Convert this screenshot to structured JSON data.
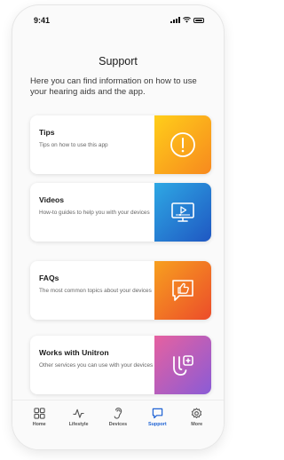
{
  "status_bar": {
    "time": "9:41"
  },
  "page": {
    "title": "Support",
    "intro": "Here you can find information on how to use your hearing aids and the app."
  },
  "cards": [
    {
      "title": "Tips",
      "description": "Tips on how to use this app",
      "icon": "exclamation-circle-icon",
      "gradient": [
        "#ffce1a",
        "#f7891e"
      ]
    },
    {
      "title": "Videos",
      "description": "How-to guides to help you with your devices",
      "icon": "monitor-play-icon",
      "gradient": [
        "#2ea8e4",
        "#1f57c2"
      ]
    },
    {
      "title": "FAQs",
      "description": "The most common topics about your devices",
      "icon": "thumbs-up-bubble-icon",
      "gradient": [
        "#f7a01f",
        "#ec4c2a"
      ]
    },
    {
      "title": "Works with Unitron",
      "description": "Other services you can use with your devices",
      "icon": "unitron-plus-icon",
      "gradient": [
        "#e661a0",
        "#8a5bd6"
      ]
    }
  ],
  "tabs": [
    {
      "label": "Home",
      "icon": "grid-icon",
      "active": false
    },
    {
      "label": "Lifestyle",
      "icon": "activity-icon",
      "active": false
    },
    {
      "label": "Devices",
      "icon": "hearing-aid-icon",
      "active": false
    },
    {
      "label": "Support",
      "icon": "chat-bubble-icon",
      "active": true
    },
    {
      "label": "More",
      "icon": "gear-icon",
      "active": false
    }
  ],
  "colors": {
    "accent": "#1f63d4",
    "background": "#fafafa"
  }
}
